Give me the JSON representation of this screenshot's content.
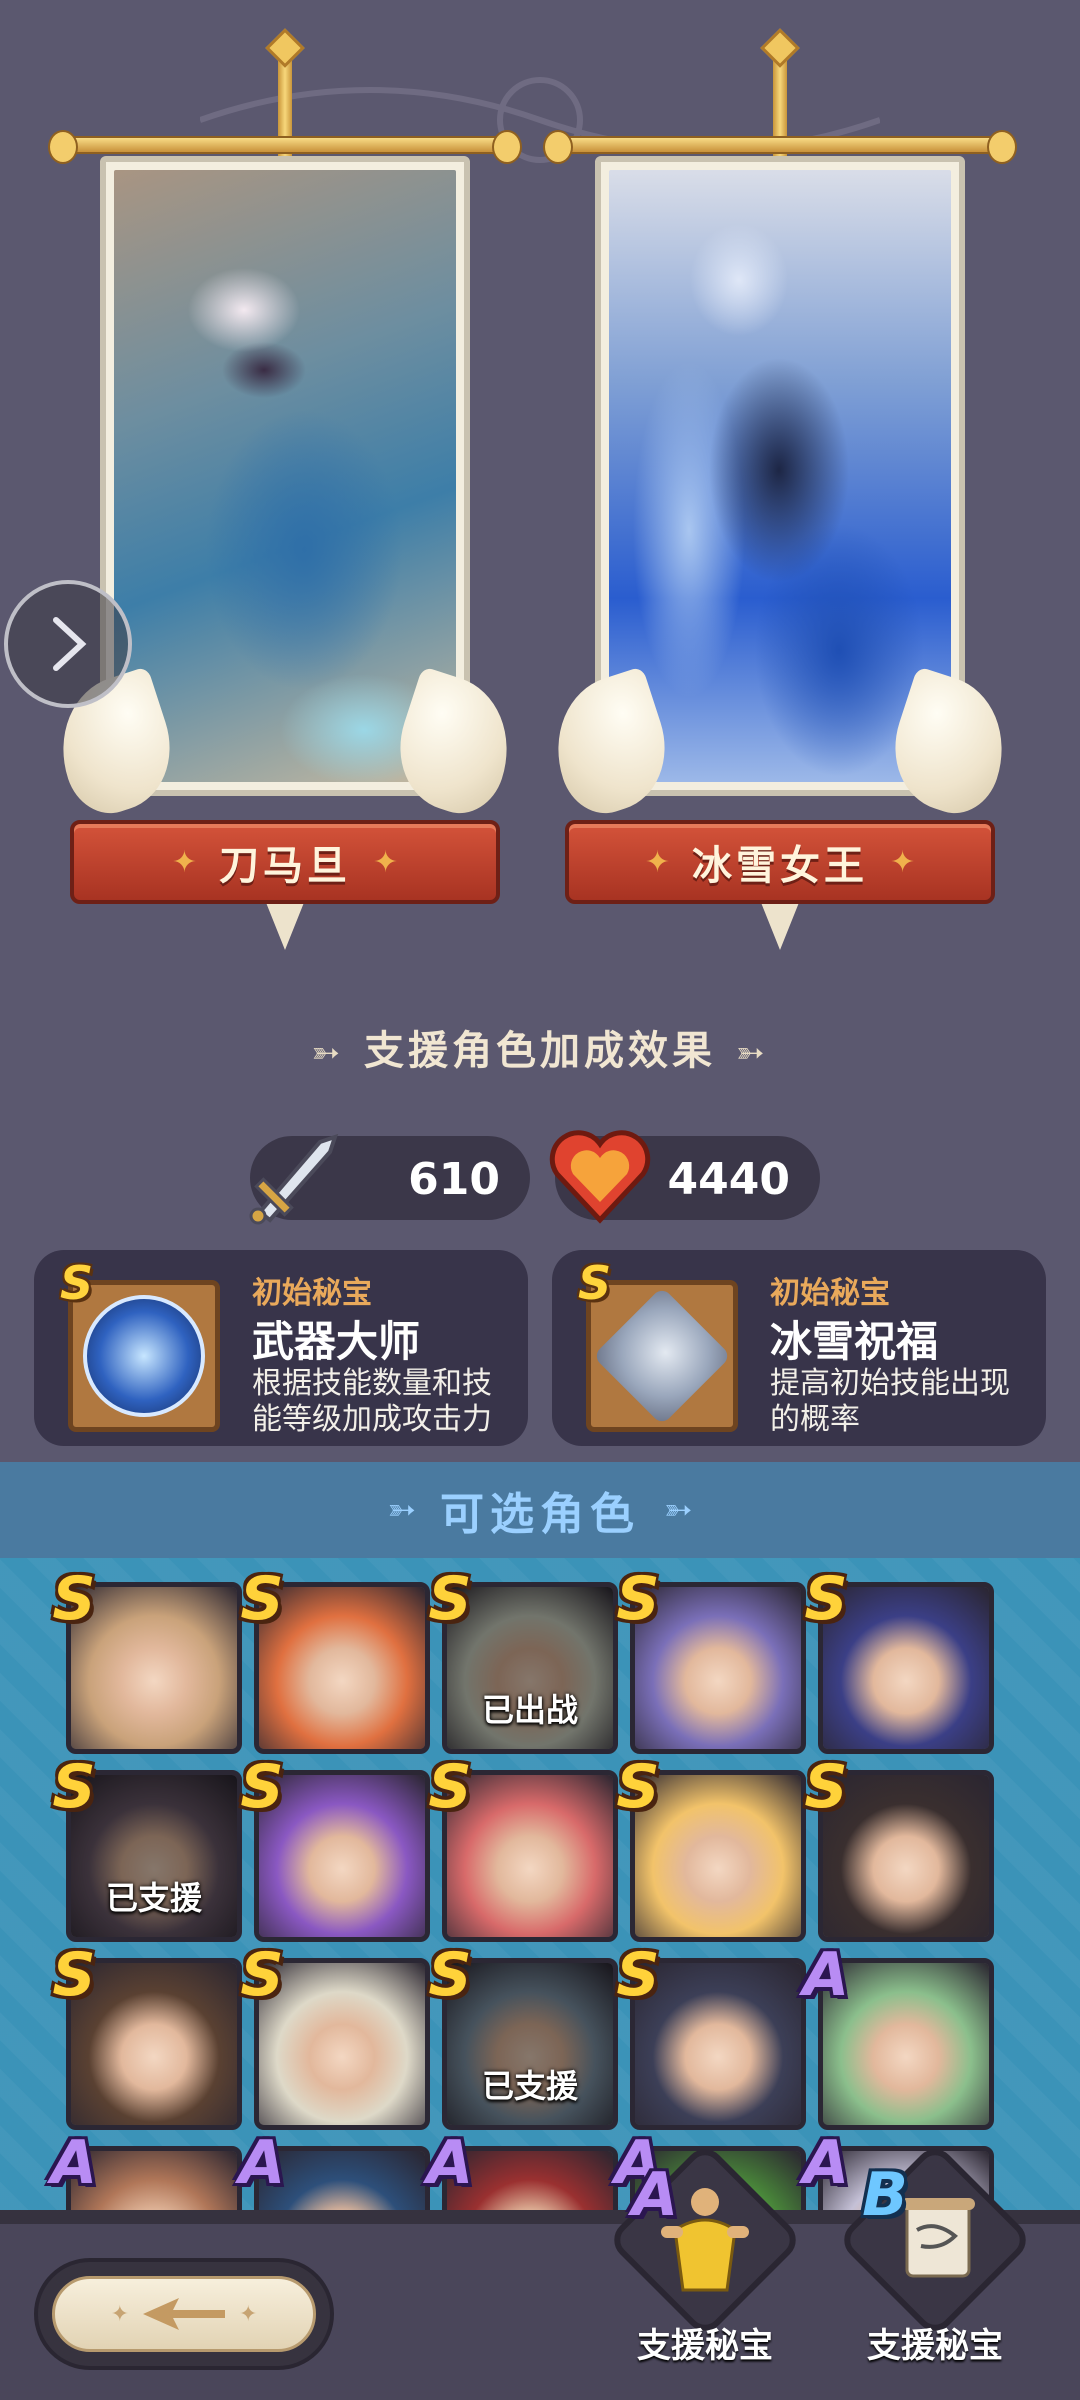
{
  "heroes": [
    {
      "name": "刀马旦",
      "slot": "left"
    },
    {
      "name": "冰雪女王",
      "slot": "right"
    }
  ],
  "bonus": {
    "title": "支援角色加成效果",
    "attack": "610",
    "hp": "4440"
  },
  "treasures": [
    {
      "rank": "S",
      "kind": "初始秘宝",
      "title": "武器大师",
      "desc": "根据技能数量和技能等级加成攻击力",
      "icon": "weapon-master-icon"
    },
    {
      "rank": "S",
      "kind": "初始秘宝",
      "title": "冰雪祝福",
      "desc": "提高初始技能出现的概率",
      "icon": "ice-blessing-icon"
    }
  ],
  "selectable": {
    "title": "可选角色",
    "characters": [
      {
        "rank": "S",
        "status": "",
        "hue": "#c9a27a"
      },
      {
        "rank": "S",
        "status": "",
        "hue": "#e07040"
      },
      {
        "rank": "S",
        "status": "已出战",
        "hue": "#cfd4c4"
      },
      {
        "rank": "S",
        "status": "",
        "hue": "#7a6fb8"
      },
      {
        "rank": "S",
        "status": "",
        "hue": "#3b3f86"
      },
      {
        "rank": "S",
        "status": "已支援",
        "hue": "#6b5a6a"
      },
      {
        "rank": "S",
        "status": "",
        "hue": "#8a58c2"
      },
      {
        "rank": "S",
        "status": "",
        "hue": "#d86a6a"
      },
      {
        "rank": "S",
        "status": "",
        "hue": "#f2c36a"
      },
      {
        "rank": "S",
        "status": "",
        "hue": "#3a2f2f"
      },
      {
        "rank": "S",
        "status": "",
        "hue": "#5a4132"
      },
      {
        "rank": "S",
        "status": "",
        "hue": "#ded9c8"
      },
      {
        "rank": "S",
        "status": "已支援",
        "hue": "#7f95a8"
      },
      {
        "rank": "S",
        "status": "",
        "hue": "#3c3f57"
      },
      {
        "rank": "A",
        "status": "",
        "hue": "#8bbf8c"
      },
      {
        "rank": "A",
        "status": "",
        "hue": "#b07658"
      },
      {
        "rank": "A",
        "status": "",
        "hue": "#2d4f7a"
      },
      {
        "rank": "A",
        "status": "",
        "hue": "#9a3030"
      },
      {
        "rank": "A",
        "status": "",
        "hue": "#4a8a3a"
      },
      {
        "rank": "A",
        "status": "",
        "hue": "#c4c0d6"
      }
    ]
  },
  "bottom": {
    "support_treasure_a": {
      "rank": "A",
      "label": "支援秘宝"
    },
    "support_treasure_b": {
      "rank": "B",
      "label": "支援秘宝"
    }
  }
}
